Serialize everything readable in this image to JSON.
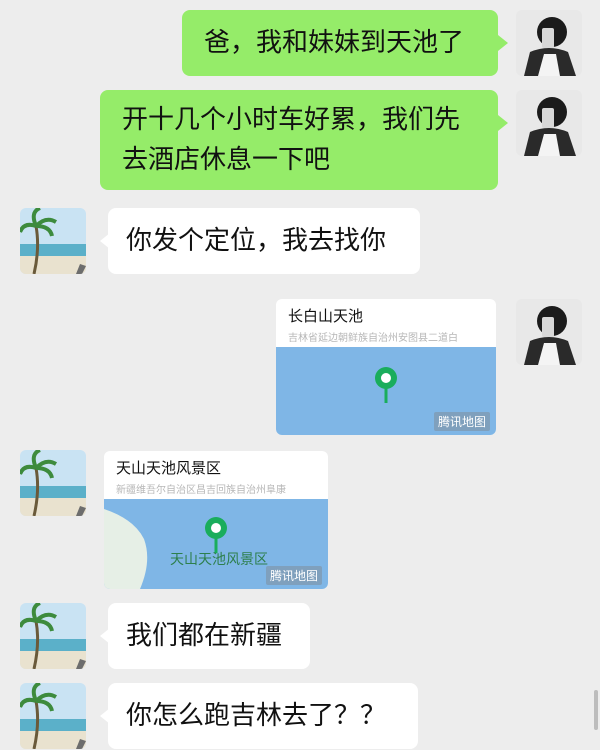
{
  "messages": {
    "m1": "爸，我和妹妹到天池了",
    "m2_line1": "开十几个小时车好累，我们先",
    "m2_line2": "去酒店休息一下吧",
    "m3": "你发个定位，我去找你",
    "m6": "我们都在新疆",
    "m7": "你怎么跑吉林去了？？"
  },
  "location_cards": {
    "sent": {
      "title": "长白山天池",
      "address": "吉林省延边朝鲜族自治州安图县二道白",
      "map_badge": "腾讯地图"
    },
    "received": {
      "title": "天山天池风景区",
      "address": "新疆维吾尔自治区昌吉回族自治州阜康",
      "map_text": "天山天池风景区",
      "map_badge": "腾讯地图"
    }
  },
  "colors": {
    "background": "#ededed",
    "my_bubble": "#95ec69",
    "their_bubble": "#ffffff",
    "map_water": "#7fb6e6",
    "map_pin": "#1aad5c"
  },
  "icons": {
    "me_avatar": "person-selfie-avatar",
    "other_avatar": "palm-tree-beach-avatar",
    "map_pin": "map-pin-icon"
  }
}
